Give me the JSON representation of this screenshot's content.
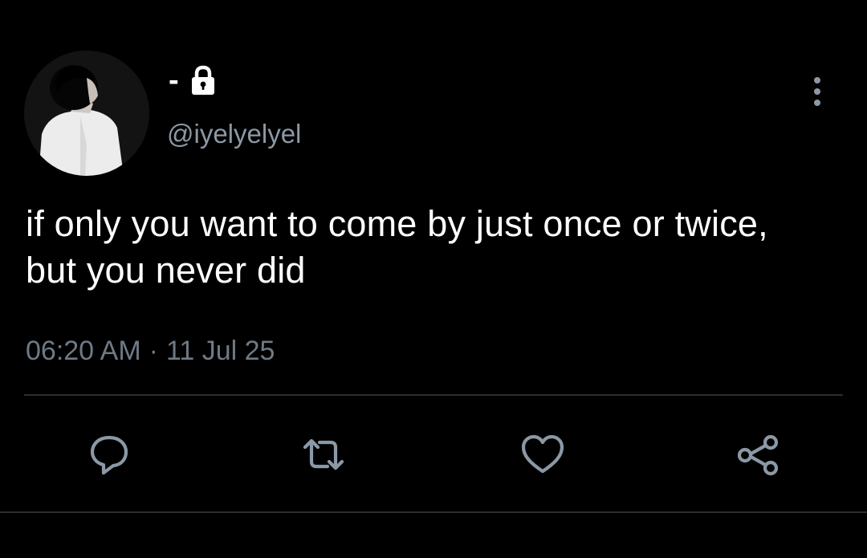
{
  "user": {
    "display_name": "-",
    "handle": "@iyelyelyel",
    "protected_icon": "lock-icon",
    "avatar_icon": "profile-photo"
  },
  "tweet": {
    "text": "if only you want to come by just once or twice, but you never did",
    "time": "06:20 AM",
    "separator": "·",
    "date": "11 Jul 25"
  },
  "actions": [
    {
      "name": "reply",
      "icon": "speech-bubble-icon"
    },
    {
      "name": "retweet",
      "icon": "retweet-arrows-icon"
    },
    {
      "name": "like",
      "icon": "heart-icon"
    },
    {
      "name": "share",
      "icon": "share-nodes-icon"
    }
  ],
  "colors": {
    "background": "#000000",
    "text": "#ffffff",
    "secondary_text": "#8b98a5",
    "divider": "#2a2f33"
  }
}
